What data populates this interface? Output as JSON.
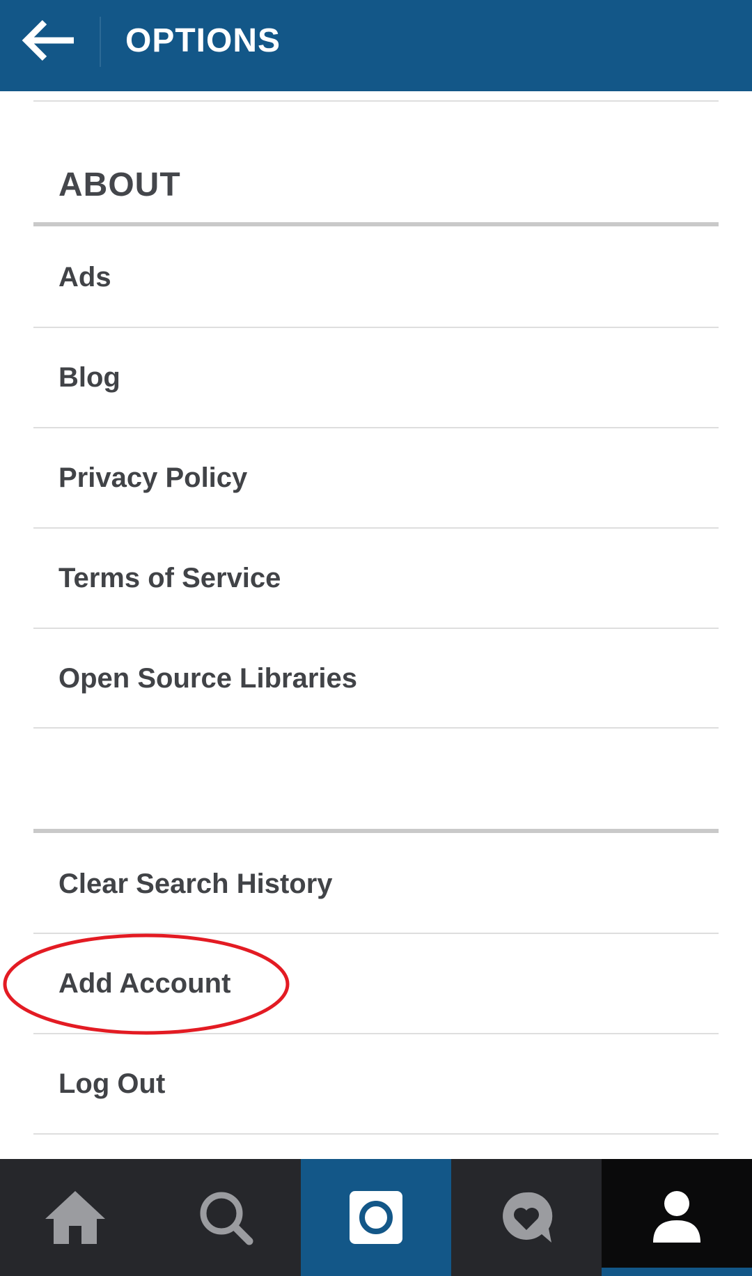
{
  "header": {
    "back_icon": "arrow-left-icon",
    "title": "OPTIONS",
    "background_color": "#135788"
  },
  "about_section": {
    "heading": "ABOUT",
    "items": [
      {
        "label": "Ads"
      },
      {
        "label": "Blog"
      },
      {
        "label": "Privacy Policy"
      },
      {
        "label": "Terms of Service"
      },
      {
        "label": "Open Source Libraries"
      }
    ]
  },
  "account_section": {
    "items": [
      {
        "label": "Clear Search History"
      },
      {
        "label": "Add Account",
        "annotated": true
      },
      {
        "label": "Log Out"
      }
    ]
  },
  "annotation": {
    "shape": "ellipse",
    "color": "#e31b23",
    "target": "Add Account"
  },
  "bottom_nav": {
    "tabs": [
      {
        "icon": "home-icon",
        "active": false
      },
      {
        "icon": "search-icon",
        "active": false
      },
      {
        "icon": "camera-icon",
        "active": false,
        "highlight_color": "#135788"
      },
      {
        "icon": "activity-heart-icon",
        "active": false
      },
      {
        "icon": "profile-icon",
        "active": true
      }
    ],
    "background_color": "#26272b",
    "active_color": "#135788"
  }
}
